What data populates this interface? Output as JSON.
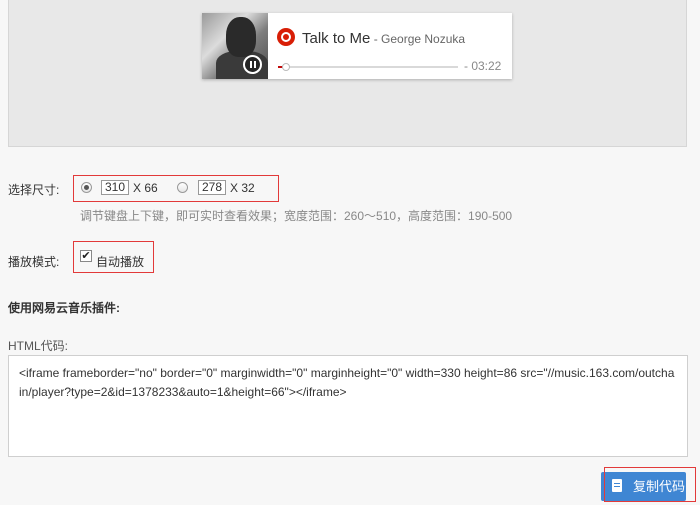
{
  "player": {
    "song_title": "Talk to Me",
    "separator": " - ",
    "artist": "George Nozuka",
    "time": "- 03:22",
    "progress": 0.04,
    "logo_icon": "netease-music-logo-icon",
    "control_icon": "pause-icon",
    "accent_color": "#d81e06"
  },
  "size": {
    "label": "选择尺寸:",
    "option1": {
      "width": "310",
      "height_text": "X 66",
      "checked": true
    },
    "option2": {
      "width": "278",
      "height_text": "X 32",
      "checked": false
    },
    "hint": "调节键盘上下键，即可实时查看效果；宽度范围：260～510，高度范围：190-500"
  },
  "mode": {
    "label": "播放模式:",
    "autoplay_label": "自动播放",
    "autoplay_checked": true
  },
  "plugin": {
    "section_title": "使用网易云音乐插件:",
    "html_label": "HTML代码:",
    "code": "<iframe frameborder=\"no\" border=\"0\" marginwidth=\"0\" marginheight=\"0\" width=330 height=86 src=\"//music.163.com/outchain/player?type=2&id=1378233&auto=1&height=66\"></iframe>"
  },
  "copy_button": {
    "label": "复制代码",
    "icon": "copy-document-icon",
    "color": "#3f86d3"
  }
}
